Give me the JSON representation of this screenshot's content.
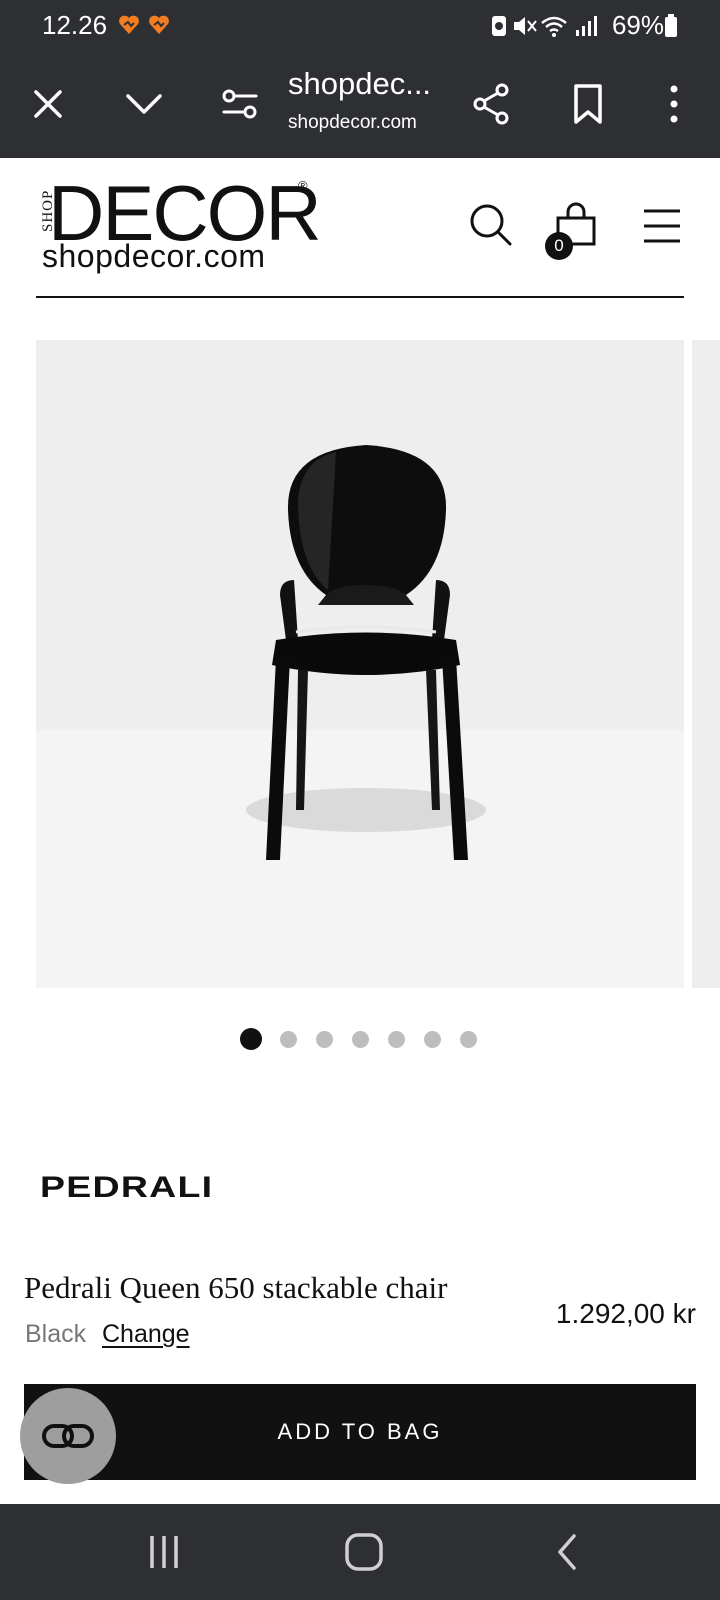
{
  "status_bar": {
    "time": "12.26",
    "battery_percent": "69%",
    "icons": [
      "heart-notification-icon",
      "heart-notification-icon",
      "data-saver-icon",
      "mute-icon",
      "wifi-icon",
      "signal-icon",
      "battery-icon"
    ]
  },
  "browser": {
    "tab_title": "shopdec...",
    "url": "shopdecor.com",
    "icons": [
      "close-icon",
      "chevron-down-icon",
      "site-settings-icon",
      "share-icon",
      "bookmark-icon",
      "more-vertical-icon"
    ]
  },
  "site_header": {
    "logo_main": "DECOR",
    "logo_vertical": "SHOP",
    "logo_reg": "®",
    "logo_domain": "shopdecor.com",
    "cart_count": "0",
    "icons": [
      "search-icon",
      "shopping-bag-icon",
      "menu-icon"
    ]
  },
  "gallery": {
    "image_count": 7,
    "active_index": 0
  },
  "product": {
    "brand": "PEDRALI",
    "title": "Pedrali Queen 650 stackable chair",
    "variant": "Black",
    "change_label": "Change",
    "price": "1.292,00 kr",
    "add_to_bag_label": "ADD TO BAG"
  },
  "colors": {
    "system_bar": "#2d2f33",
    "button": "#111111",
    "dot_active": "#111111",
    "dot_inactive": "#bdbdbd",
    "notification_orange": "#f47c20"
  },
  "nav_bar": {
    "icons": [
      "recent-apps-icon",
      "home-icon",
      "back-icon"
    ]
  }
}
